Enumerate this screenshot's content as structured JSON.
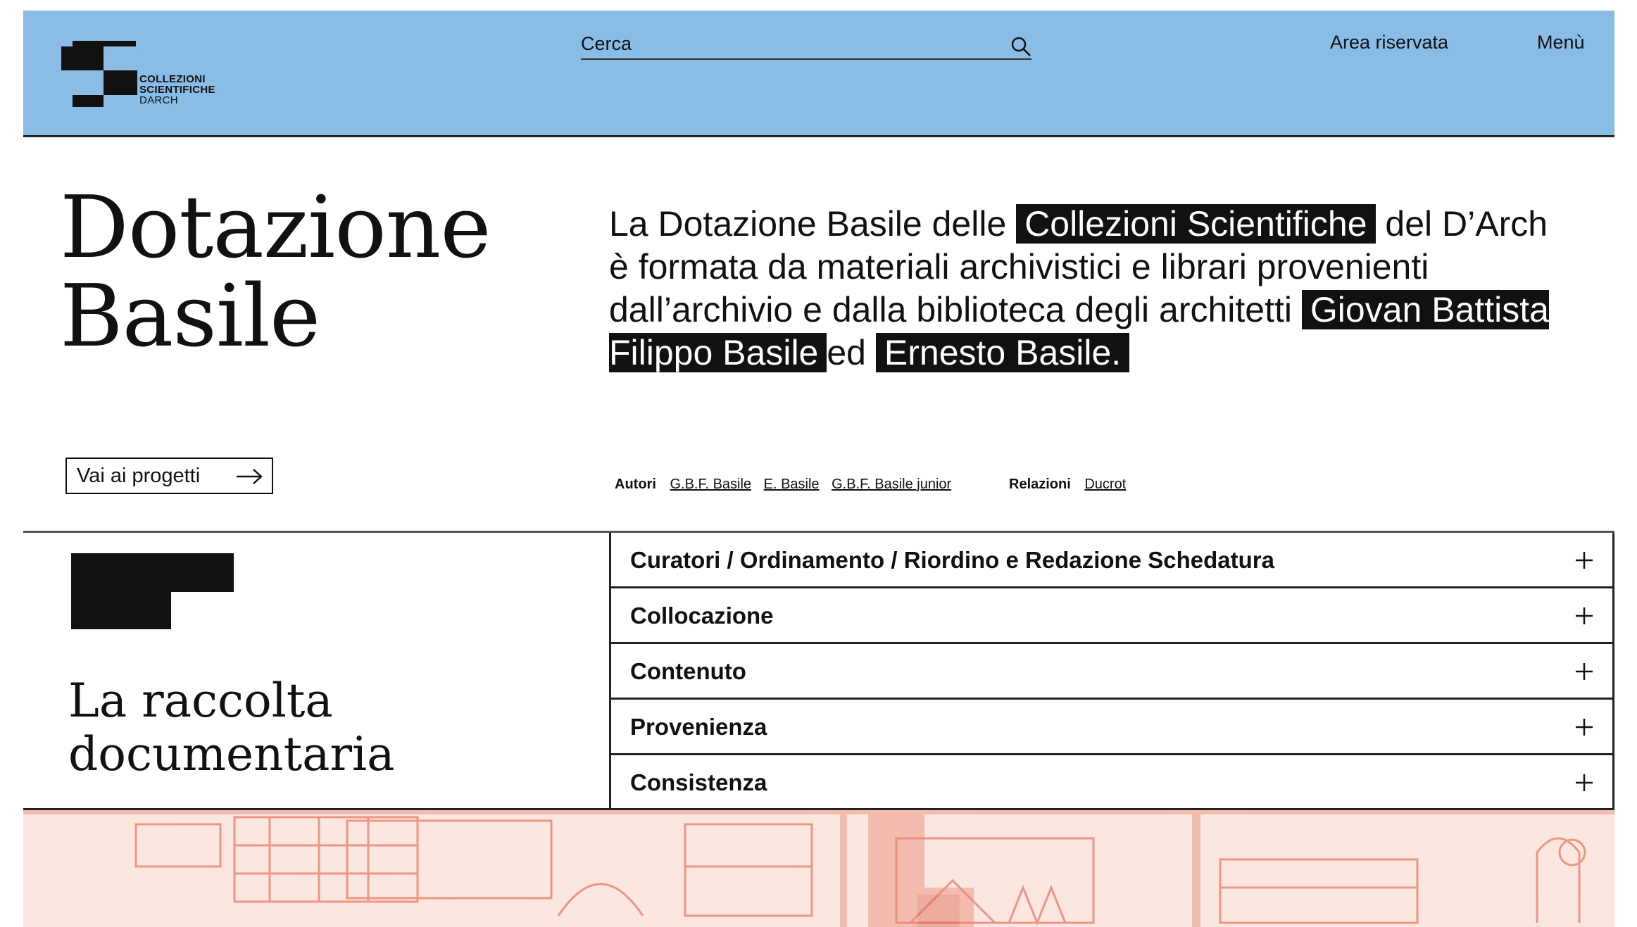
{
  "header": {
    "logo": {
      "line1": "COLLEZIONI",
      "line2": "SCIENTIFICHE",
      "line3": "DARCH"
    },
    "search_placeholder": "Cerca",
    "nav": {
      "reserved_area": "Area riservata",
      "menu": "Menù"
    },
    "color": "#89bde6"
  },
  "hero": {
    "title_line1": "Dotazione",
    "title_line2": "Basile",
    "intro": {
      "part1": "La Dotazione Basile delle ",
      "hl1": "Collezioni Scientifiche",
      "part2": " del D’Arch è formata da materiali archivistici e librari provenienti dall’archivio e dalla biblioteca degli architetti ",
      "hl2": "Giovan Battista Filippo Basile",
      "part3": "ed ",
      "hl3": "Ernesto Basile."
    },
    "projects_button": "Vai ai progetti",
    "authors_label": "Autori",
    "authors": [
      "G.B.F. Basile",
      "E. Basile",
      "G.B.F. Basile junior"
    ],
    "relations_label": "Relazioni",
    "relations": [
      "Ducrot"
    ]
  },
  "raccolta": {
    "title_line1": "La raccolta",
    "title_line2": "documentaria"
  },
  "accordion": {
    "items": [
      {
        "label": "Curatori / Ordinamento / Riordino e Redazione Schedatura"
      },
      {
        "label": "Collocazione"
      },
      {
        "label": "Contenuto"
      },
      {
        "label": "Provenienza"
      },
      {
        "label": "Consistenza"
      }
    ]
  },
  "image_strip_color": "#f08f7a"
}
